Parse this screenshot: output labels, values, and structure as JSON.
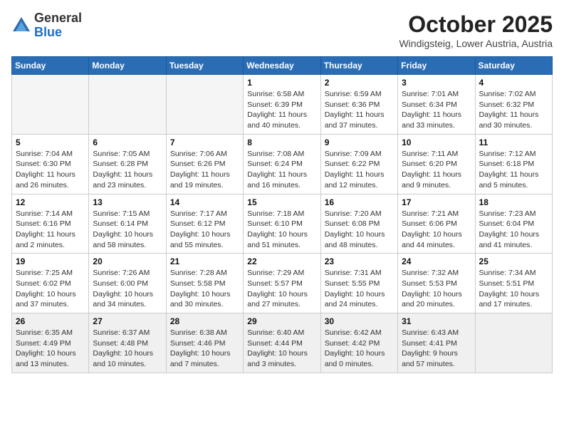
{
  "header": {
    "logo_general": "General",
    "logo_blue": "Blue",
    "month": "October 2025",
    "location": "Windigsteig, Lower Austria, Austria"
  },
  "weekdays": [
    "Sunday",
    "Monday",
    "Tuesday",
    "Wednesday",
    "Thursday",
    "Friday",
    "Saturday"
  ],
  "weeks": [
    [
      {
        "day": "",
        "info": ""
      },
      {
        "day": "",
        "info": ""
      },
      {
        "day": "",
        "info": ""
      },
      {
        "day": "1",
        "info": "Sunrise: 6:58 AM\nSunset: 6:39 PM\nDaylight: 11 hours\nand 40 minutes."
      },
      {
        "day": "2",
        "info": "Sunrise: 6:59 AM\nSunset: 6:36 PM\nDaylight: 11 hours\nand 37 minutes."
      },
      {
        "day": "3",
        "info": "Sunrise: 7:01 AM\nSunset: 6:34 PM\nDaylight: 11 hours\nand 33 minutes."
      },
      {
        "day": "4",
        "info": "Sunrise: 7:02 AM\nSunset: 6:32 PM\nDaylight: 11 hours\nand 30 minutes."
      }
    ],
    [
      {
        "day": "5",
        "info": "Sunrise: 7:04 AM\nSunset: 6:30 PM\nDaylight: 11 hours\nand 26 minutes."
      },
      {
        "day": "6",
        "info": "Sunrise: 7:05 AM\nSunset: 6:28 PM\nDaylight: 11 hours\nand 23 minutes."
      },
      {
        "day": "7",
        "info": "Sunrise: 7:06 AM\nSunset: 6:26 PM\nDaylight: 11 hours\nand 19 minutes."
      },
      {
        "day": "8",
        "info": "Sunrise: 7:08 AM\nSunset: 6:24 PM\nDaylight: 11 hours\nand 16 minutes."
      },
      {
        "day": "9",
        "info": "Sunrise: 7:09 AM\nSunset: 6:22 PM\nDaylight: 11 hours\nand 12 minutes."
      },
      {
        "day": "10",
        "info": "Sunrise: 7:11 AM\nSunset: 6:20 PM\nDaylight: 11 hours\nand 9 minutes."
      },
      {
        "day": "11",
        "info": "Sunrise: 7:12 AM\nSunset: 6:18 PM\nDaylight: 11 hours\nand 5 minutes."
      }
    ],
    [
      {
        "day": "12",
        "info": "Sunrise: 7:14 AM\nSunset: 6:16 PM\nDaylight: 11 hours\nand 2 minutes."
      },
      {
        "day": "13",
        "info": "Sunrise: 7:15 AM\nSunset: 6:14 PM\nDaylight: 10 hours\nand 58 minutes."
      },
      {
        "day": "14",
        "info": "Sunrise: 7:17 AM\nSunset: 6:12 PM\nDaylight: 10 hours\nand 55 minutes."
      },
      {
        "day": "15",
        "info": "Sunrise: 7:18 AM\nSunset: 6:10 PM\nDaylight: 10 hours\nand 51 minutes."
      },
      {
        "day": "16",
        "info": "Sunrise: 7:20 AM\nSunset: 6:08 PM\nDaylight: 10 hours\nand 48 minutes."
      },
      {
        "day": "17",
        "info": "Sunrise: 7:21 AM\nSunset: 6:06 PM\nDaylight: 10 hours\nand 44 minutes."
      },
      {
        "day": "18",
        "info": "Sunrise: 7:23 AM\nSunset: 6:04 PM\nDaylight: 10 hours\nand 41 minutes."
      }
    ],
    [
      {
        "day": "19",
        "info": "Sunrise: 7:25 AM\nSunset: 6:02 PM\nDaylight: 10 hours\nand 37 minutes."
      },
      {
        "day": "20",
        "info": "Sunrise: 7:26 AM\nSunset: 6:00 PM\nDaylight: 10 hours\nand 34 minutes."
      },
      {
        "day": "21",
        "info": "Sunrise: 7:28 AM\nSunset: 5:58 PM\nDaylight: 10 hours\nand 30 minutes."
      },
      {
        "day": "22",
        "info": "Sunrise: 7:29 AM\nSunset: 5:57 PM\nDaylight: 10 hours\nand 27 minutes."
      },
      {
        "day": "23",
        "info": "Sunrise: 7:31 AM\nSunset: 5:55 PM\nDaylight: 10 hours\nand 24 minutes."
      },
      {
        "day": "24",
        "info": "Sunrise: 7:32 AM\nSunset: 5:53 PM\nDaylight: 10 hours\nand 20 minutes."
      },
      {
        "day": "25",
        "info": "Sunrise: 7:34 AM\nSunset: 5:51 PM\nDaylight: 10 hours\nand 17 minutes."
      }
    ],
    [
      {
        "day": "26",
        "info": "Sunrise: 6:35 AM\nSunset: 4:49 PM\nDaylight: 10 hours\nand 13 minutes."
      },
      {
        "day": "27",
        "info": "Sunrise: 6:37 AM\nSunset: 4:48 PM\nDaylight: 10 hours\nand 10 minutes."
      },
      {
        "day": "28",
        "info": "Sunrise: 6:38 AM\nSunset: 4:46 PM\nDaylight: 10 hours\nand 7 minutes."
      },
      {
        "day": "29",
        "info": "Sunrise: 6:40 AM\nSunset: 4:44 PM\nDaylight: 10 hours\nand 3 minutes."
      },
      {
        "day": "30",
        "info": "Sunrise: 6:42 AM\nSunset: 4:42 PM\nDaylight: 10 hours\nand 0 minutes."
      },
      {
        "day": "31",
        "info": "Sunrise: 6:43 AM\nSunset: 4:41 PM\nDaylight: 9 hours\nand 57 minutes."
      },
      {
        "day": "",
        "info": ""
      }
    ]
  ]
}
